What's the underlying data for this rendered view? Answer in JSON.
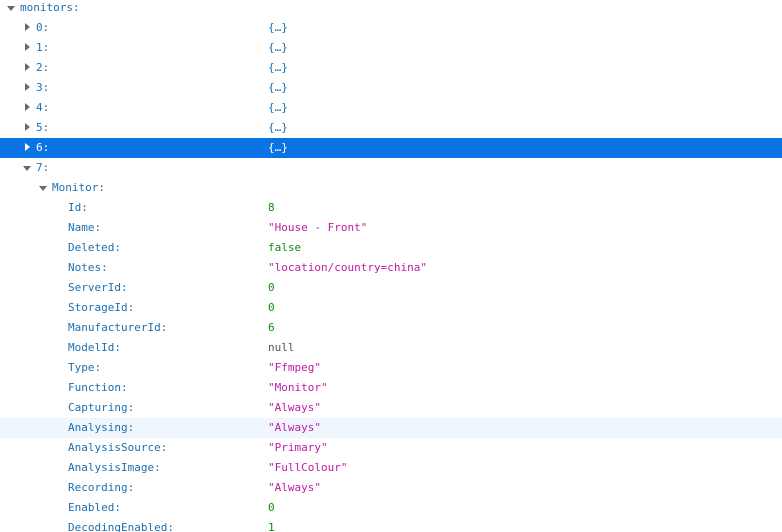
{
  "viewer": {
    "root_key": "monitors:",
    "collapsed_value": "{…}",
    "items": [
      {
        "key": "0:",
        "value": "{…}"
      },
      {
        "key": "1:",
        "value": "{…}"
      },
      {
        "key": "2:",
        "value": "{…}"
      },
      {
        "key": "3:",
        "value": "{…}"
      },
      {
        "key": "4:",
        "value": "{…}"
      },
      {
        "key": "5:",
        "value": "{…}"
      },
      {
        "key": "6:",
        "value": "{…}",
        "selected": true
      },
      {
        "key": "7:"
      }
    ],
    "monitor_key": "Monitor:",
    "fields": [
      {
        "key": "Id:",
        "value": "8",
        "type": "num"
      },
      {
        "key": "Name:",
        "value": "\"House - Front\"",
        "type": "str"
      },
      {
        "key": "Deleted:",
        "value": "false",
        "type": "bool"
      },
      {
        "key": "Notes:",
        "value": "\"location/country=china\"",
        "type": "str"
      },
      {
        "key": "ServerId:",
        "value": "0",
        "type": "num"
      },
      {
        "key": "StorageId:",
        "value": "0",
        "type": "num"
      },
      {
        "key": "ManufacturerId:",
        "value": "6",
        "type": "num"
      },
      {
        "key": "ModelId:",
        "value": "null",
        "type": "null"
      },
      {
        "key": "Type:",
        "value": "\"Ffmpeg\"",
        "type": "str"
      },
      {
        "key": "Function:",
        "value": "\"Monitor\"",
        "type": "str"
      },
      {
        "key": "Capturing:",
        "value": "\"Always\"",
        "type": "str"
      },
      {
        "key": "Analysing:",
        "value": "\"Always\"",
        "type": "str",
        "hovered": true
      },
      {
        "key": "AnalysisSource:",
        "value": "\"Primary\"",
        "type": "str"
      },
      {
        "key": "AnalysisImage:",
        "value": "\"FullColour\"",
        "type": "str"
      },
      {
        "key": "Recording:",
        "value": "\"Always\"",
        "type": "str"
      },
      {
        "key": "Enabled:",
        "value": "0",
        "type": "num"
      },
      {
        "key": "DecodingEnabled:",
        "value": "1",
        "type": "num"
      }
    ]
  }
}
